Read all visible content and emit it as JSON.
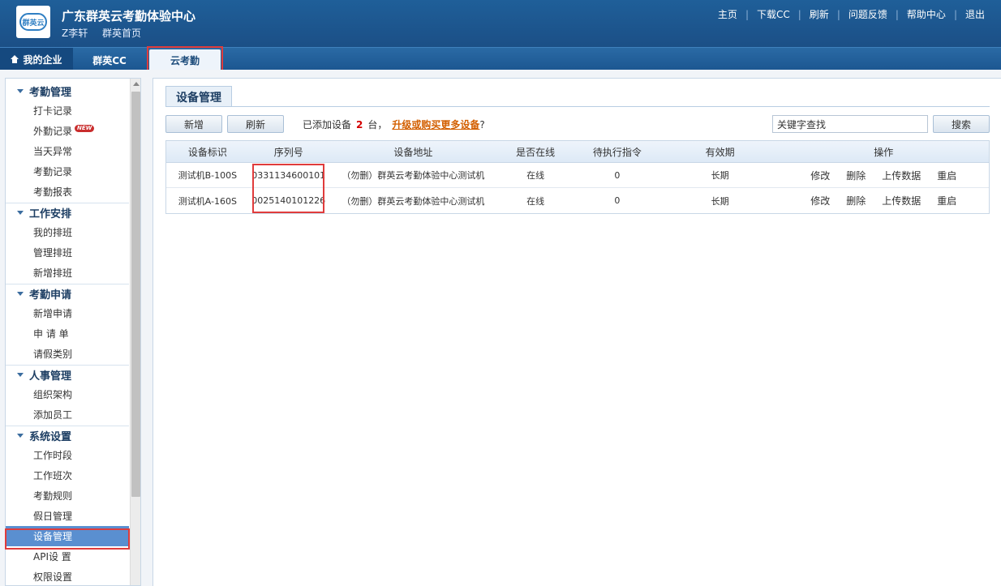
{
  "header": {
    "app_title": "广东群英云考勤体验中心",
    "logo_text": "群英云",
    "user_name": "Z李轩",
    "home_link": "群英首页",
    "top_links": [
      "主页",
      "下载CC",
      "刷新",
      "问题反馈",
      "帮助中心",
      "退出"
    ],
    "separator": "|"
  },
  "nav": {
    "tabs": [
      "我的企业",
      "群英CC",
      "云考勤"
    ],
    "active": "云考勤"
  },
  "sidebar": {
    "groups": [
      {
        "title": "考勤管理",
        "items": [
          "打卡记录",
          "外勤记录",
          "当天异常",
          "考勤记录",
          "考勤报表"
        ]
      },
      {
        "title": "工作安排",
        "items": [
          "我的排班",
          "管理排班",
          "新增排班"
        ]
      },
      {
        "title": "考勤申请",
        "items": [
          "新增申请",
          "申 请 单",
          "请假类别"
        ]
      },
      {
        "title": "人事管理",
        "items": [
          "组织架构",
          "添加员工"
        ]
      },
      {
        "title": "系统设置",
        "items": [
          "工作时段",
          "工作班次",
          "考勤规则",
          "假日管理",
          "设备管理",
          "API设 置",
          "权限设置"
        ]
      }
    ],
    "new_badge": "NEW",
    "active_item": "设备管理"
  },
  "main": {
    "panel_title": "设备管理",
    "add_button": "新增",
    "refresh_button": "刷新",
    "count_prefix": "已添加设备",
    "device_count": "2",
    "count_suffix": "台，",
    "upgrade_link": "升级或购买更多设备",
    "upgrade_suffix": "?",
    "search_value": "关键字查找",
    "search_button": "搜索"
  },
  "table": {
    "columns": [
      "设备标识",
      "序列号",
      "设备地址",
      "是否在线",
      "待执行指令",
      "有效期",
      "操作"
    ],
    "rows": [
      {
        "id": "测试机B-100S",
        "serial": "0331134600101",
        "address": "（勿删）群英云考勤体验中心测试机",
        "online": "在线",
        "pending": "0",
        "validity": "长期"
      },
      {
        "id": "测试机A-160S",
        "serial": "0025140101226",
        "address": "（勿删）群英云考勤体验中心测试机",
        "online": "在线",
        "pending": "0",
        "validity": "长期"
      }
    ],
    "ops": [
      "修改",
      "删除",
      "上传数据",
      "重启"
    ]
  },
  "colors": {
    "header_bg": "#1f5f99",
    "highlight_border": "#e03c3c",
    "active_sidebar": "#5a8fd0",
    "count_red": "#d40000",
    "link_orange": "#d35f00"
  }
}
